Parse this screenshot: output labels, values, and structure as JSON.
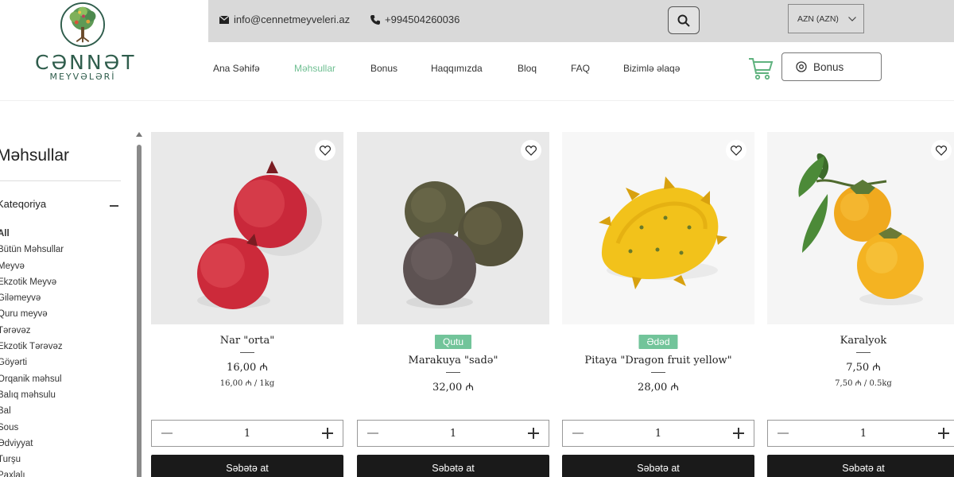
{
  "header": {
    "brand": "CƏNNƏT",
    "brand_sub": "MEYVƏLƏRİ",
    "email": "info@cennetmeyveleri.az",
    "phone": "+994504260036",
    "currency": "AZN (AZN)",
    "bonus_label": "Bonus"
  },
  "nav": [
    {
      "label": "Ana Səhifə",
      "active": false
    },
    {
      "label": "Məhsullar",
      "active": true
    },
    {
      "label": "Bonus",
      "active": false
    },
    {
      "label": "Haqqımızda",
      "active": false
    },
    {
      "label": "Bloq",
      "active": false
    },
    {
      "label": "FAQ",
      "active": false
    },
    {
      "label": "Bizimlə əlaqə",
      "active": false
    }
  ],
  "sidebar": {
    "title": "Məhsullar",
    "category_heading": "Kateqoriya",
    "items": [
      "All",
      "Bütün Məhsullar",
      "Meyvə",
      "Ekzotik Meyvə",
      "Giləmeyvə",
      "Quru meyvə",
      "Tərəvəz",
      "Ekzotik Tərəvəz",
      "Göyərti",
      "Orqanik məhsul",
      "Balıq məhsulu",
      "Bal",
      "Sous",
      "Ədviyyat",
      "Turşu",
      "Paxlalı"
    ]
  },
  "products": [
    {
      "name": "Nar \"orta\"",
      "tag": "",
      "price": "16,00 ₼",
      "unit": "16,00 ₼ / 1kg",
      "qty": "1",
      "add_label": "Səbətə at"
    },
    {
      "name": "Marakuya \"sadə\"",
      "tag": "Qutu",
      "price": "32,00 ₼",
      "unit": "",
      "qty": "1",
      "add_label": "Səbətə at"
    },
    {
      "name": "Pitaya \"Dragon fruit yellow\"",
      "tag": "Ədəd",
      "price": "28,00 ₼",
      "unit": "",
      "qty": "1",
      "add_label": "Səbətə at"
    },
    {
      "name": "Karalyok",
      "tag": "",
      "price": "7,50 ₼",
      "unit": "7,50 ₼ / 0.5kg",
      "qty": "1",
      "add_label": "Səbətə at"
    }
  ],
  "colors": {
    "accent": "#6fbf92",
    "tag_bg": "#72c49a",
    "topbar_bg": "#d9d9d9",
    "button_dark": "#1a1a1a"
  }
}
